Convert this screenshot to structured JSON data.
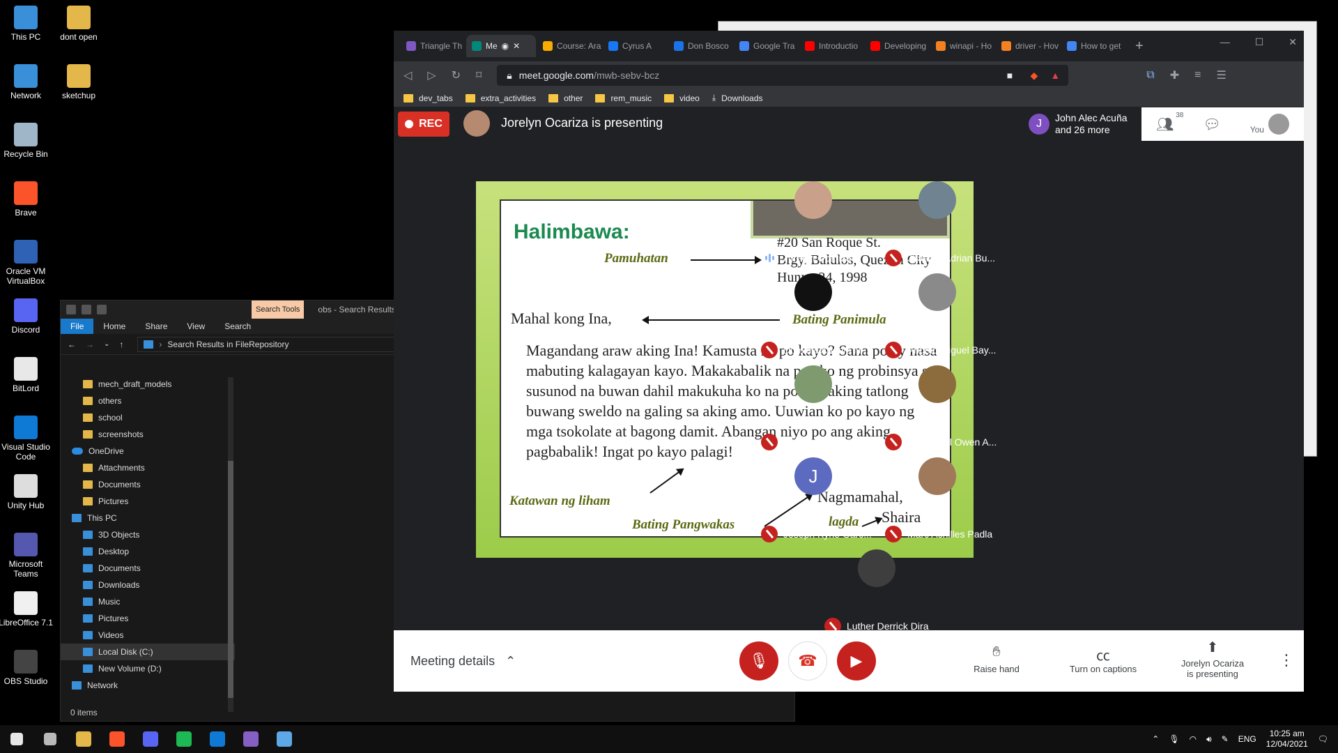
{
  "desktop": {
    "icons": [
      {
        "label": "This PC",
        "icon": "pc-icon",
        "color": "#3a8fd9"
      },
      {
        "label": "dont open",
        "icon": "folder-icon",
        "color": "#e4b74a"
      },
      {
        "label": "Network",
        "icon": "network-icon",
        "color": "#3a8fd9"
      },
      {
        "label": "sketchup",
        "icon": "folder-icon",
        "color": "#e4b74a"
      },
      {
        "label": "Recycle Bin",
        "icon": "recycle-bin-icon",
        "color": "#9fb6c9"
      },
      {
        "label": "Brave",
        "icon": "brave-icon",
        "color": "#fb542b"
      },
      {
        "label": "Oracle VM VirtualBox",
        "icon": "virtualbox-icon",
        "color": "#2f61b4"
      },
      {
        "label": "Discord",
        "icon": "discord-icon",
        "color": "#5865f2"
      },
      {
        "label": "BitLord",
        "icon": "bitlord-icon",
        "color": "#e8e8e8"
      },
      {
        "label": "Visual Studio Code",
        "icon": "vscode-icon",
        "color": "#0f7ad6"
      },
      {
        "label": "Unity Hub",
        "icon": "unity-icon",
        "color": "#dddddd"
      },
      {
        "label": "Microsoft Teams",
        "icon": "teams-icon",
        "color": "#5558af"
      },
      {
        "label": "LibreOffice 7.1",
        "icon": "libreoffice-icon",
        "color": "#f0f0f0"
      },
      {
        "label": "OBS Studio",
        "icon": "obs-icon",
        "color": "#444444"
      }
    ]
  },
  "explorer": {
    "search_tools": "Search Tools",
    "title": "obs - Search Results in FileRep",
    "ribbon": [
      "File",
      "Home",
      "Share",
      "View",
      "Search"
    ],
    "address": "Search Results in FileRepository",
    "nav": [
      {
        "label": "mech_draft_models",
        "type": "folder"
      },
      {
        "label": "others",
        "type": "folder"
      },
      {
        "label": "school",
        "type": "folder"
      },
      {
        "label": "screenshots",
        "type": "folder"
      },
      {
        "label": "OneDrive",
        "type": "cloud"
      },
      {
        "label": "Attachments",
        "type": "folder"
      },
      {
        "label": "Documents",
        "type": "folder"
      },
      {
        "label": "Pictures",
        "type": "folder"
      },
      {
        "label": "This PC",
        "type": "pc"
      },
      {
        "label": "3D Objects",
        "type": "pc"
      },
      {
        "label": "Desktop",
        "type": "pc"
      },
      {
        "label": "Documents",
        "type": "pc"
      },
      {
        "label": "Downloads",
        "type": "pc"
      },
      {
        "label": "Music",
        "type": "pc"
      },
      {
        "label": "Pictures",
        "type": "pc"
      },
      {
        "label": "Videos",
        "type": "pc"
      },
      {
        "label": "Local Disk (C:)",
        "type": "drive"
      },
      {
        "label": "New Volume (D:)",
        "type": "drive"
      },
      {
        "label": "Network",
        "type": "pc"
      }
    ],
    "status": "0 items"
  },
  "browser": {
    "tabs": [
      {
        "label": "Triangle Th",
        "color": "#7e57c2"
      },
      {
        "label": "Me",
        "color": "#00897b"
      },
      {
        "label": "Course: Ara",
        "color": "#f9ab00"
      },
      {
        "label": "Cyrus A",
        "color": "#1877f2"
      },
      {
        "label": "Don Bosco",
        "color": "#1a73e8"
      },
      {
        "label": "Google Tra",
        "color": "#4285f4"
      },
      {
        "label": "Introductio",
        "color": "#ff0000"
      },
      {
        "label": "Developing",
        "color": "#ff0000"
      },
      {
        "label": "winapi - Ho",
        "color": "#f48024"
      },
      {
        "label": "driver - Hov",
        "color": "#f48024"
      },
      {
        "label": "How to get",
        "color": "#4285f4"
      }
    ],
    "url_host": "meet.google.com",
    "url_path": "/mwb-sebv-bcz",
    "bookmarks": [
      "dev_tabs",
      "extra_activities",
      "other",
      "rem_music",
      "video",
      "Downloads"
    ]
  },
  "meet": {
    "rec": "REC",
    "presenting_text": "Jorelyn Ocariza is presenting",
    "people_card_initial": "J",
    "people_card_text_1": "John Alec Acuña",
    "people_card_text_2": "and 26 more",
    "people_count": "38",
    "you_label": "You",
    "participants": [
      {
        "name": "Jorelyn Ocariza",
        "muted": false,
        "color": "#c9a18a"
      },
      {
        "name": "Jhasper Adrian Bu...",
        "muted": true,
        "color": "#6f8391"
      },
      {
        "name": "Dominic Angelo N...",
        "muted": true,
        "color": "#111111"
      },
      {
        "name": "Angelo Miguel Bay...",
        "muted": true,
        "color": "#8a8a8a"
      },
      {
        "name": "Joross Clark Tabar",
        "muted": true,
        "color": "#7f9a6e"
      },
      {
        "name": "Nathanael Owen A...",
        "muted": true,
        "color": "#8c6b3d"
      },
      {
        "name": "Joseph Kyne Garc...",
        "muted": true,
        "color": "#5c6bc0",
        "initial": "J"
      },
      {
        "name": "Marc Achilles Padla",
        "muted": true,
        "color": "#a0785a"
      },
      {
        "name": "Luther Derrick Dira",
        "muted": true,
        "color": "#3e3e3e"
      }
    ],
    "meeting_details": "Meeting details",
    "raise_hand": "Raise hand",
    "captions": "Turn on captions",
    "present_1": "Jorelyn Ocariza",
    "present_2": "is presenting"
  },
  "slide": {
    "heading": "Halimbawa:",
    "pamuhatan_label": "Pamuhatan",
    "address_1": "#20 San Roque St.",
    "address_2": "Brgy. Balulos, Quezon City",
    "address_3": "Hunyo 24, 1998",
    "greeting": "Mahal kong Ina,",
    "greeting_label": "Bating Panimula",
    "body": "Magandang araw aking Ina! Kamusta na po kayo?  Sana po ay nasa mabuting kalagayan kayo. Makakabalik na po ako ng probinsya sa susunod na buwan dahil makukuha ko na po ang aking tatlong buwang sweldo na galing sa aking amo.  Uuwian ko po kayo ng mga tsokolate at bagong damit. Abangan niyo po ang aking pagbabalik! Ingat po kayo palagi!",
    "body_label": "Katawan ng liham",
    "closing": "Nagmamahal,",
    "signature": "Shaira",
    "closing_label": "Bating Pangwakas",
    "signature_label": "lagda"
  },
  "taskbar": {
    "apps": [
      {
        "icon": "windows-start-icon",
        "color": "#ffffff"
      },
      {
        "icon": "task-view-icon",
        "color": "#cccccc"
      },
      {
        "icon": "file-explorer-icon",
        "color": "#e4b74a"
      },
      {
        "icon": "brave-icon",
        "color": "#fb542b"
      },
      {
        "icon": "discord-icon",
        "color": "#5865f2"
      },
      {
        "icon": "spotify-icon",
        "color": "#1db954"
      },
      {
        "icon": "vscode-icon",
        "color": "#0f7ad6"
      },
      {
        "icon": "visual-studio-icon",
        "color": "#865fc5"
      },
      {
        "icon": "virtualbox-icon",
        "color": "#5fa8e8"
      }
    ],
    "lang": "ENG",
    "time": "10:25 am",
    "date": "12/04/2021"
  }
}
